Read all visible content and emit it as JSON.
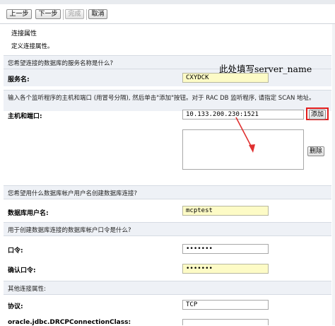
{
  "toolbar": {
    "prev_label": "上一步",
    "next_label": "下一步",
    "finish_label": "完成",
    "cancel_label": "取消"
  },
  "header": {
    "title": "连接属性",
    "subtitle": "定义连接属性。"
  },
  "service_section": {
    "prompt": "您希望连接的数据库的服务名称是什么?",
    "label": "服务名:",
    "value": "CXYDCK"
  },
  "annotation": {
    "text": "此处填写server_name",
    "color": "#e03030"
  },
  "listener_section": {
    "prompt": "输入各个监听程序的主机和端口 (用冒号分隔), 然后单击\"添加\"按钮。对于 RAC DB 监听程序, 请指定 SCAN 地址。",
    "label": "主机和端口:",
    "value": "10.133.200.230:1521",
    "add_label": "添加",
    "delete_label": "删除",
    "list_items": []
  },
  "user_section": {
    "prompt": "您希望用什么数据库帐户用户名创建数据库连接?",
    "label": "数据库用户名:",
    "value": "mcptest"
  },
  "password_section": {
    "prompt": "用于创建数据库连接的数据库帐户口令是什么?",
    "password_label": "口令:",
    "password_value": "•••••••",
    "confirm_label": "确认口令:",
    "confirm_value": "•••••••"
  },
  "other_section": {
    "prompt": "其他连接属性:",
    "protocol_label": "协议:",
    "protocol_value": "TCP",
    "connclass_label": "oracle.jdbc.DRCPConnectionClass:",
    "connclass_value": ""
  }
}
